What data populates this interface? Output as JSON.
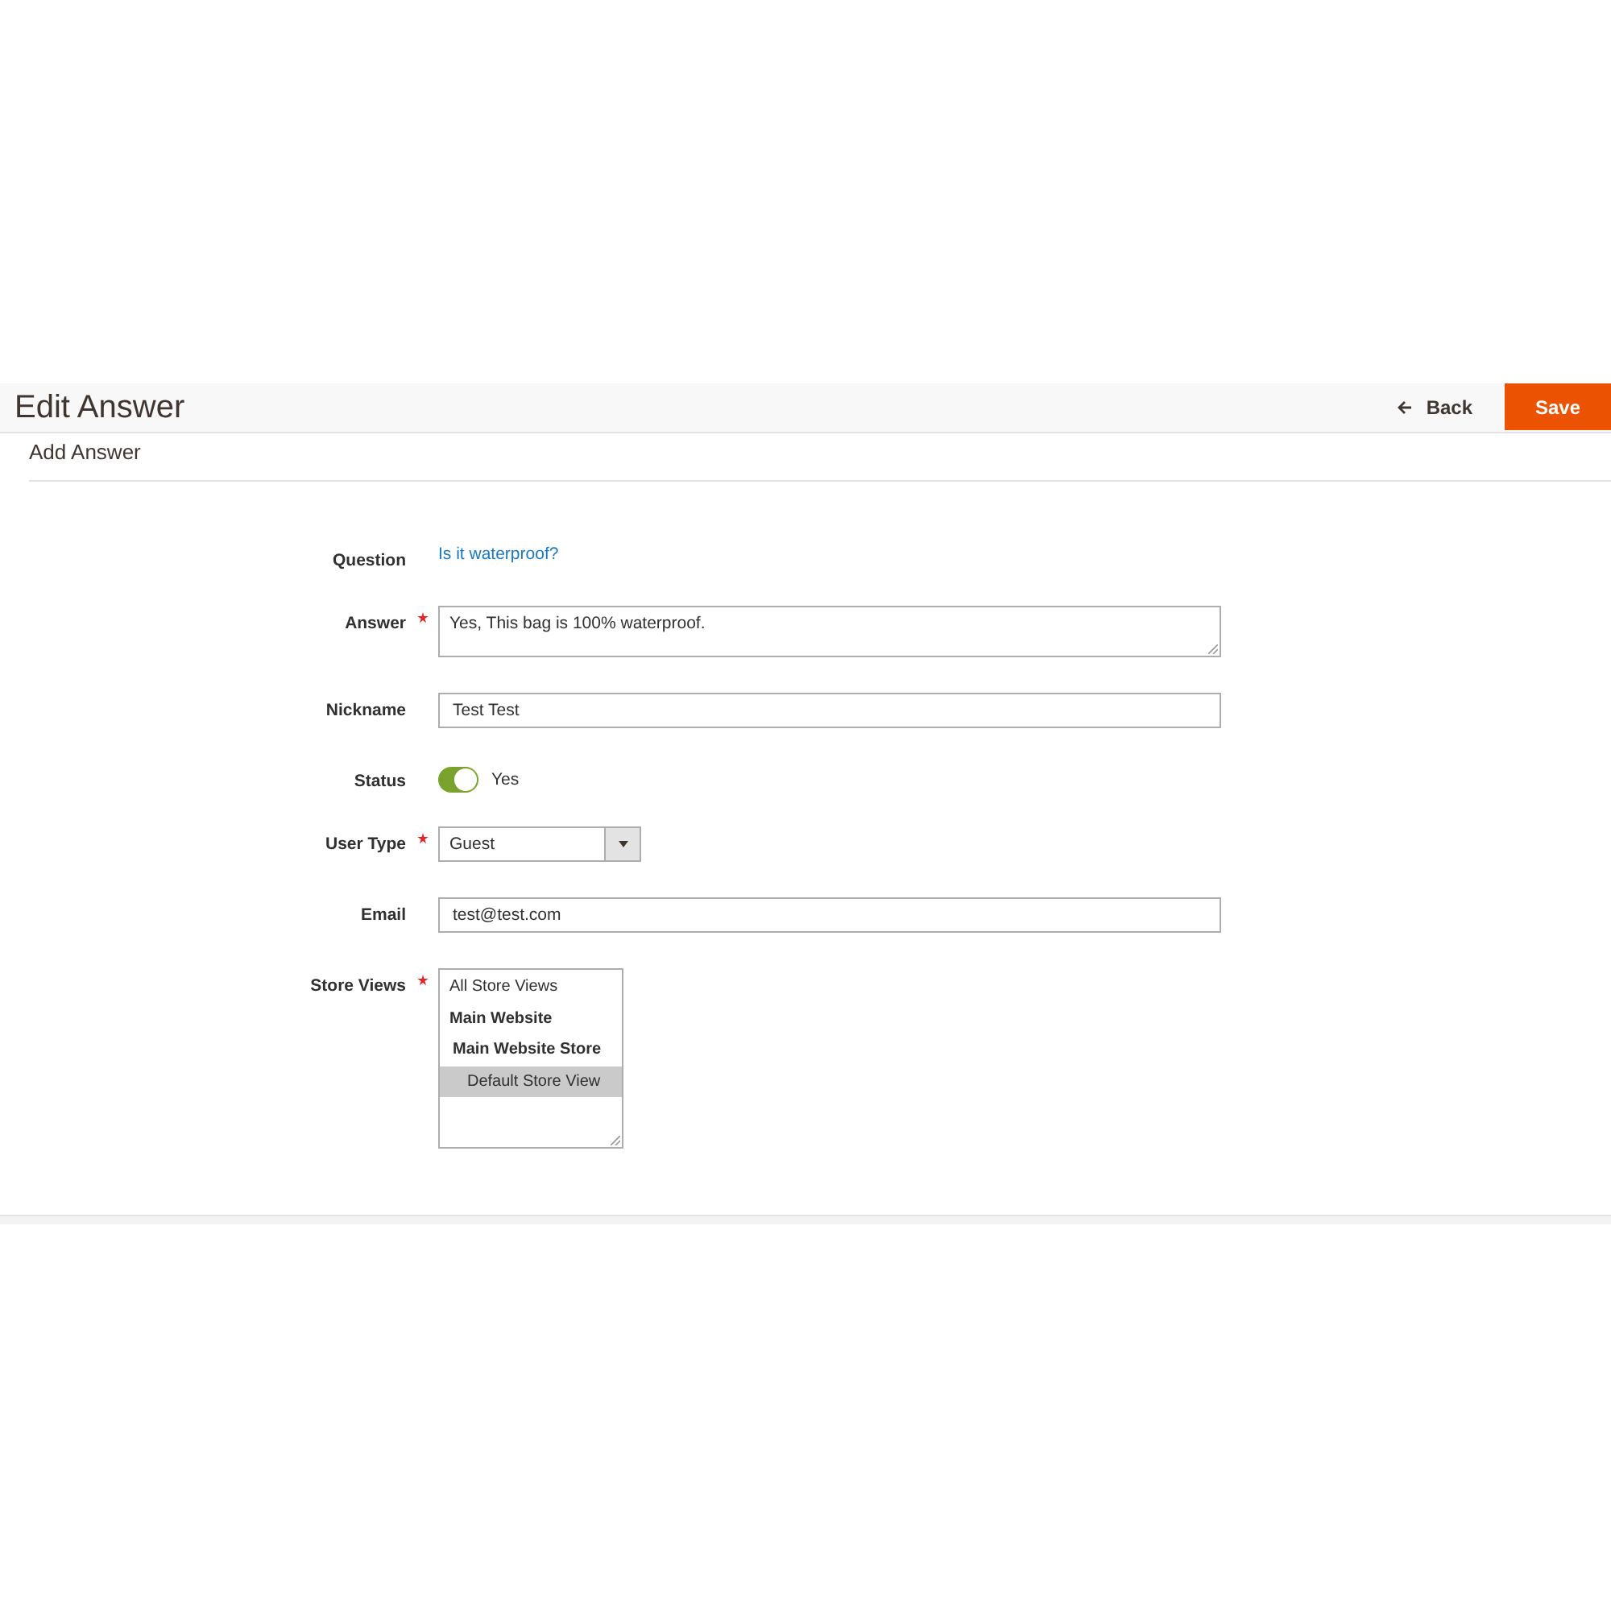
{
  "header": {
    "title": "Edit Answer",
    "back_button": "Back",
    "save_button": "Save"
  },
  "section": {
    "title": "Add Answer"
  },
  "fields": [
    {
      "kind": "link",
      "label": "Question",
      "required": false,
      "value": "Is it waterproof?"
    },
    {
      "kind": "textarea",
      "label": "Answer",
      "required": true,
      "value": "Yes, This bag is 100% waterproof."
    },
    {
      "kind": "text",
      "label": "Nickname",
      "required": false,
      "value": "Test Test"
    },
    {
      "kind": "toggle",
      "label": "Status",
      "required": false,
      "on": true,
      "value": "Yes"
    },
    {
      "kind": "select",
      "label": "User Type",
      "required": true,
      "value": "Guest"
    },
    {
      "kind": "text",
      "label": "Email",
      "required": false,
      "value": "test@test.com"
    },
    {
      "kind": "multiselect",
      "label": "Store Views",
      "required": true,
      "options": [
        {
          "label": "All Store Views",
          "selected": false
        },
        {
          "label": "Main Website",
          "selected": false,
          "children": [
            {
              "label": "Main Website Store",
              "selected": false,
              "children": [
                {
                  "label": "Default Store View",
                  "selected": true
                }
              ]
            }
          ]
        }
      ]
    }
  ]
}
